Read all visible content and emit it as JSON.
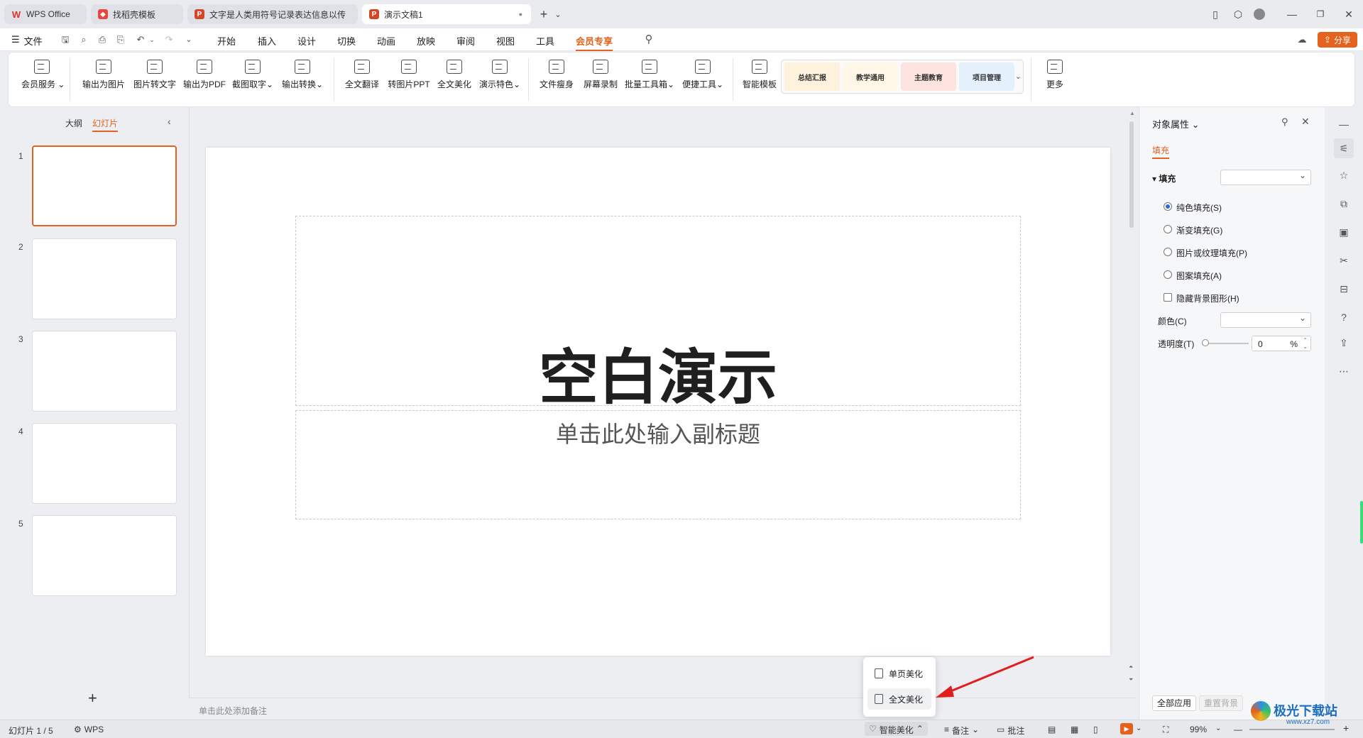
{
  "tabs": [
    {
      "label": "WPS Office",
      "icon": "wps-logo-icon",
      "color": "#d9342b",
      "active": false
    },
    {
      "label": "找稻壳模板",
      "icon": "docer-icon",
      "color": "#e6473f",
      "active": false
    },
    {
      "label": "文字是人类用符号记录表达信息以传",
      "icon": "ppt-icon",
      "color": "#d24726",
      "active": false
    },
    {
      "label": "演示文稿1",
      "icon": "ppt-icon",
      "color": "#d24726",
      "active": true
    }
  ],
  "menu": {
    "file": "文件",
    "items": [
      "开始",
      "插入",
      "设计",
      "切换",
      "动画",
      "放映",
      "审阅",
      "视图",
      "工具",
      "会员专享"
    ],
    "active": "会员专享",
    "share": "分享"
  },
  "ribbon": {
    "buttons": [
      {
        "label": "会员服务",
        "icon": "vip-diamond-icon",
        "dropdown": true
      },
      {
        "label": "输出为图片",
        "icon": "export-image-icon",
        "dropdown": false
      },
      {
        "label": "图片转文字",
        "icon": "image-to-text-icon",
        "dropdown": false
      },
      {
        "label": "输出为PDF",
        "icon": "export-pdf-icon",
        "dropdown": false
      },
      {
        "label": "截图取字",
        "icon": "ocr-icon",
        "dropdown": true
      },
      {
        "label": "输出转换",
        "icon": "convert-icon",
        "dropdown": true
      },
      {
        "label": "全文翻译",
        "icon": "translate-icon",
        "dropdown": false
      },
      {
        "label": "转图片PPT",
        "icon": "to-image-ppt-icon",
        "dropdown": false
      },
      {
        "label": "全文美化",
        "icon": "beautify-icon",
        "dropdown": false
      },
      {
        "label": "演示特色",
        "icon": "feature-icon",
        "dropdown": true
      },
      {
        "label": "文件瘦身",
        "icon": "compress-icon",
        "dropdown": false
      },
      {
        "label": "屏幕录制",
        "icon": "record-icon",
        "dropdown": false
      },
      {
        "label": "批量工具箱",
        "icon": "toolbox-icon",
        "dropdown": true
      },
      {
        "label": "便捷工具",
        "icon": "tools-icon",
        "dropdown": true
      },
      {
        "label": "智能模板",
        "icon": "smart-template-icon",
        "dropdown": false
      }
    ],
    "templates": [
      "总结汇报",
      "教学通用",
      "主题教育",
      "项目管理"
    ],
    "more": "更多"
  },
  "left_panel": {
    "tabs": [
      "大纲",
      "幻灯片"
    ],
    "active_tab": "幻灯片",
    "slides": [
      "1",
      "2",
      "3",
      "4",
      "5"
    ],
    "add": "+"
  },
  "slide": {
    "title": "空白演示",
    "subtitle": "单击此处输入副标题"
  },
  "notes_placeholder": "单击此处添加备注",
  "popup": {
    "items": [
      "单页美化",
      "全文美化"
    ]
  },
  "properties": {
    "title": "对象属性",
    "tab": "填充",
    "section": "填充",
    "options": [
      {
        "label": "纯色填充(S)",
        "type": "radio",
        "checked": true
      },
      {
        "label": "渐变填充(G)",
        "type": "radio",
        "checked": false
      },
      {
        "label": "图片或纹理填充(P)",
        "type": "radio",
        "checked": false
      },
      {
        "label": "图案填充(A)",
        "type": "radio",
        "checked": false
      },
      {
        "label": "隐藏背景图形(H)",
        "type": "checkbox",
        "checked": false
      }
    ],
    "color_label": "颜色(C)",
    "transparency_label": "透明度(T)",
    "transparency_value": "0",
    "transparency_unit": "%",
    "apply_all": "全部应用",
    "reset_bg": "重置背景"
  },
  "status": {
    "slide_info": "幻灯片 1 / 5",
    "theme": "WPS",
    "smart_beautify": "智能美化",
    "notes": "备注",
    "comments": "批注",
    "zoom": "99%"
  },
  "watermark": {
    "text": "极光下载站",
    "url": "www.xz7.com"
  },
  "accent": "#e2621e"
}
